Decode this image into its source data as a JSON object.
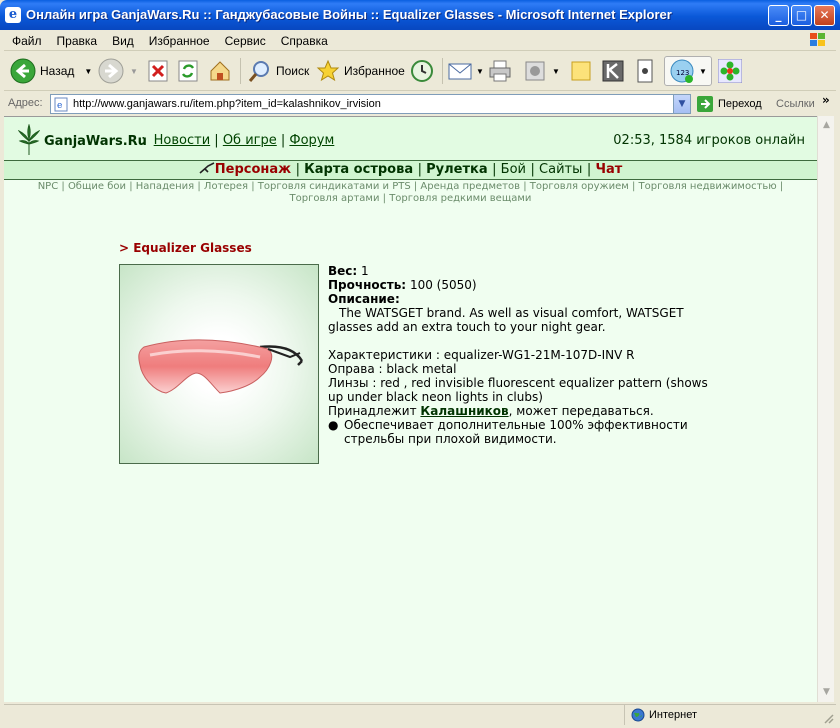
{
  "window": {
    "title": "Онлайн игра GanjaWars.Ru :: Ганджубасовые Войны :: Equalizer Glasses - Microsoft Internet Explorer",
    "buttons": {
      "minimize": "_",
      "maximize": "□",
      "close": "✕"
    }
  },
  "menu": [
    "Файл",
    "Правка",
    "Вид",
    "Избранное",
    "Сервис",
    "Справка"
  ],
  "toolbar": {
    "back": "Назад",
    "search": "Поиск",
    "favorites": "Избранное"
  },
  "address": {
    "label": "Адрес:",
    "url": "http://www.ganjawars.ru/item.php?item_id=kalashnikov_irvision",
    "go": "Переход",
    "links": "Ссылки"
  },
  "site": {
    "logo": "GanjaWars.Ru",
    "topnav": {
      "sep": ":",
      "items": [
        "Новости",
        "Об игре",
        "Форум"
      ]
    },
    "online": "02:53, 1584 игроков онлайн",
    "mainnav": [
      {
        "label": "Персонаж",
        "style": "red"
      },
      {
        "label": "Карта острова",
        "style": "grn"
      },
      {
        "label": "Рулетка",
        "style": "grn"
      },
      {
        "label": "Бой",
        "style": "nrm"
      },
      {
        "label": "Сайты",
        "style": "nrm"
      },
      {
        "label": "Чат",
        "style": "red"
      }
    ],
    "subnav": [
      "NPC",
      "Общие бои",
      "Нападения",
      "Лотерея",
      "Торговля синдикатами и PTS",
      "Аренда предметов",
      "Торговля оружием",
      "Торговля недвижимостью",
      "Торговля артами",
      "Торговля редкими вещами"
    ]
  },
  "item": {
    "title": "> Equalizer Glasses",
    "weight_label": "Вес:",
    "weight": "1",
    "durability_label": "Прочность:",
    "durability": "100 (5050)",
    "description_label": "Описание:",
    "description": "The WATSGET brand. As well as visual comfort, WATSGET glasses add an extra touch to your night gear.",
    "specs": "Характеристики : equalizer-WG1-21M-107D-INV R",
    "frame": "Оправа : black metal",
    "lenses": "Линзы : red , red invisible fluorescent equalizer pattern (shows up under black neon lights in clubs)",
    "owner_prefix": "Принадлежит",
    "owner": "Калашников",
    "owner_suffix": ", может передаваться.",
    "bonus": "Обеспечивает дополнительные 100% эффективности стрельбы при плохой видимости."
  },
  "status": {
    "zone": "Интернет"
  },
  "colors": {
    "page_bg": "#f0fef0",
    "accent_red": "#990000",
    "accent_green": "#003300"
  }
}
